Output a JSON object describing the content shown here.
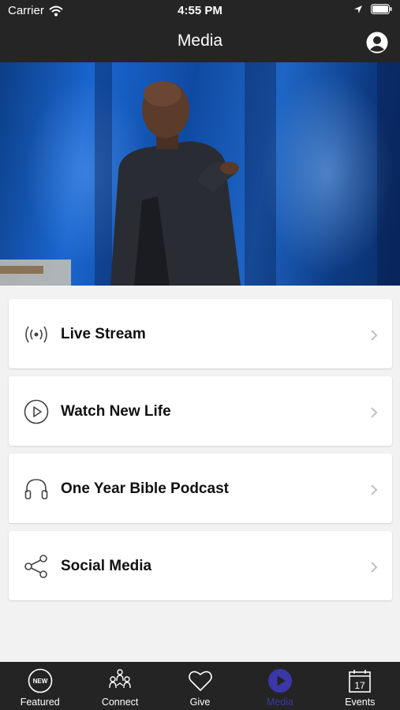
{
  "status_bar": {
    "carrier": "Carrier",
    "time": "4:55 PM"
  },
  "nav": {
    "title": "Media"
  },
  "menu": [
    {
      "label": "Live Stream",
      "icon": "broadcast-icon"
    },
    {
      "label": "Watch New Life",
      "icon": "play-circle-icon"
    },
    {
      "label": "One Year Bible Podcast",
      "icon": "headphones-icon"
    },
    {
      "label": "Social Media",
      "icon": "share-icon"
    }
  ],
  "tabs": [
    {
      "label": "Featured",
      "icon": "new-badge-icon",
      "badge_text": "NEW",
      "active": false
    },
    {
      "label": "Connect",
      "icon": "people-group-icon",
      "active": false
    },
    {
      "label": "Give",
      "icon": "heart-icon",
      "active": false
    },
    {
      "label": "Media",
      "icon": "play-icon",
      "active": true
    },
    {
      "label": "Events",
      "icon": "calendar-icon",
      "calendar_day": "17",
      "active": false
    }
  ],
  "colors": {
    "bar_background": "#252525",
    "active_tab": "#3a37a8",
    "page_background": "#f2f2f2"
  }
}
